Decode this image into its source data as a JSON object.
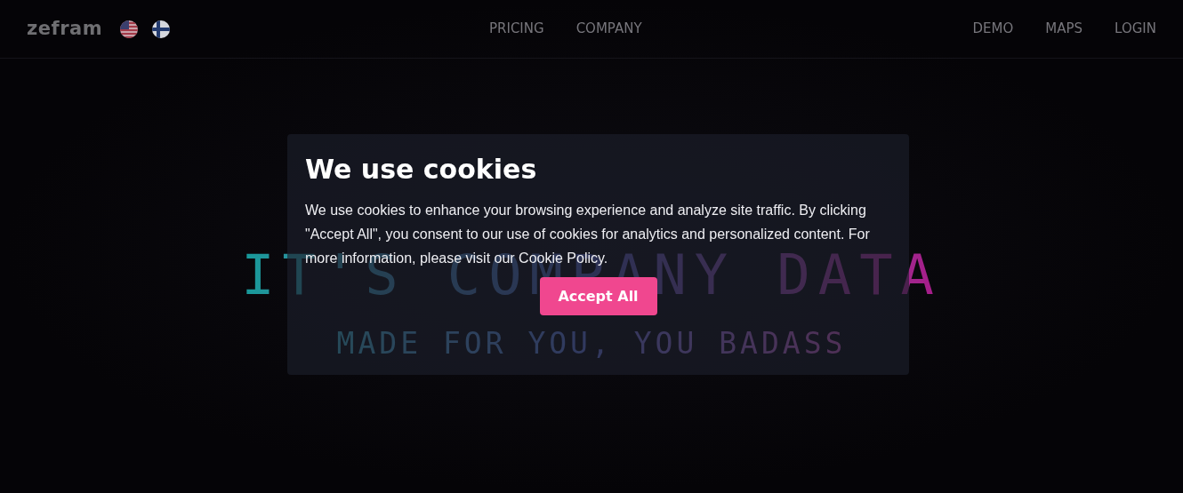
{
  "header": {
    "logo": "zefram",
    "languages": [
      {
        "kind": "us"
      },
      {
        "kind": "fi"
      }
    ],
    "nav_center": [
      "PRICING",
      "COMPANY"
    ],
    "nav_right": [
      "DEMO",
      "MAPS",
      "LOGIN"
    ]
  },
  "hero": {
    "title": "IT'S COMPANY DATA",
    "subtitle": "MADE FOR YOU, YOU BADASS"
  },
  "cookie_dialog": {
    "title": "We use cookies",
    "text": "We use cookies to enhance your browsing experience and analyze site traffic. By clicking \"Accept All\", you consent to our use of cookies for analytics and personalized content. For more information, please visit our Cookie Policy.",
    "button": "Accept All"
  }
}
